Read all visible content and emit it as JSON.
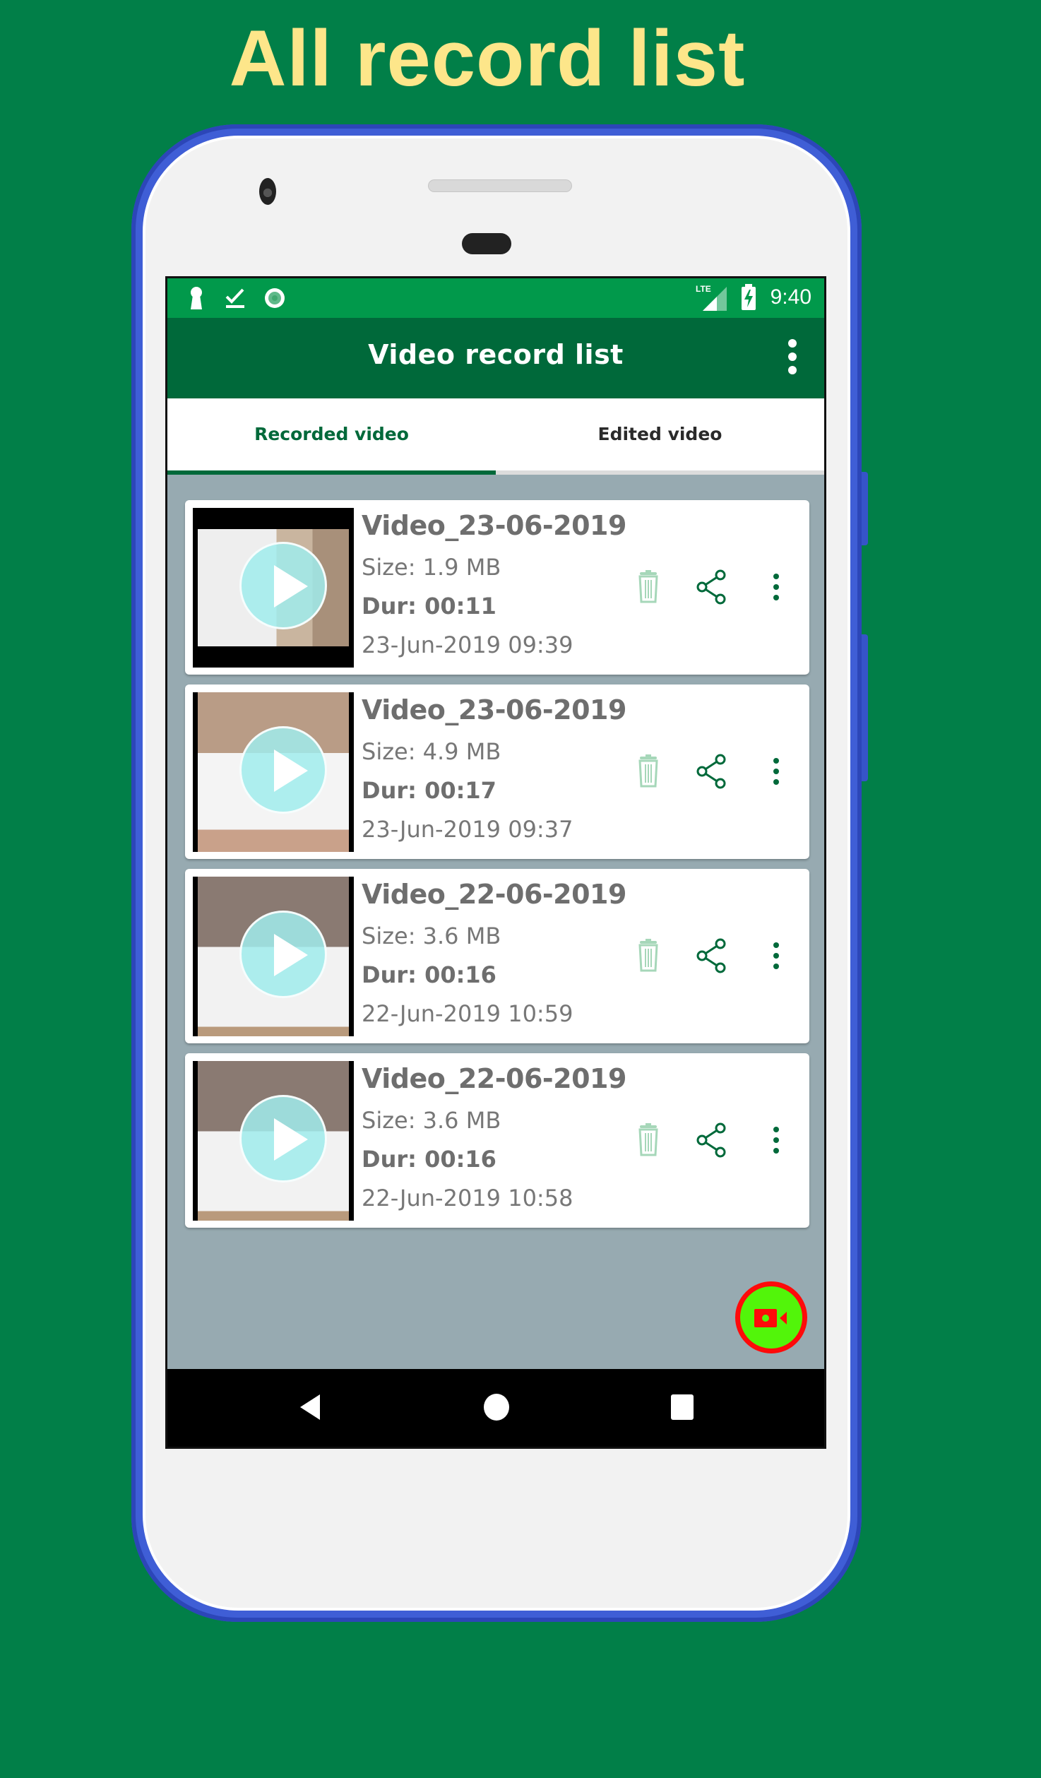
{
  "promo": {
    "title": "All record list"
  },
  "colors": {
    "background": "#017f48",
    "title_yellow": "#fde68a",
    "status_bar": "#01994b",
    "app_bar": "#00693a",
    "accent": "#00693a",
    "list_bg": "#97aab1",
    "fab_fill": "#52f50a",
    "fab_ring": "#ff0a0a"
  },
  "status_bar": {
    "left_icons": [
      "keyhole-icon",
      "download-done-icon",
      "record-circle-icon"
    ],
    "network_label": "LTE",
    "time": "9:40"
  },
  "app_bar": {
    "title": "Video record list",
    "menu_icon": "more-vert-icon"
  },
  "tabs": [
    {
      "label": "Recorded video",
      "selected": true
    },
    {
      "label": "Edited video",
      "selected": false
    }
  ],
  "videos": [
    {
      "title": "Video_23-06-2019",
      "size": "Size: 1.9 MB",
      "duration": "Dur: 00:11",
      "date": "23-Jun-2019 09:39"
    },
    {
      "title": "Video_23-06-2019",
      "size": "Size: 4.9 MB",
      "duration": "Dur: 00:17",
      "date": "23-Jun-2019 09:37"
    },
    {
      "title": "Video_22-06-2019",
      "size": "Size: 3.6 MB",
      "duration": "Dur: 00:16",
      "date": "22-Jun-2019 10:59"
    },
    {
      "title": "Video_22-06-2019",
      "size": "Size: 3.6 MB",
      "duration": "Dur: 00:16",
      "date": "22-Jun-2019 10:58"
    }
  ],
  "item_actions": [
    "delete-icon",
    "share-icon",
    "more-vert-icon"
  ],
  "fab": {
    "icon": "videocam-icon"
  },
  "nav_bar": {
    "buttons": [
      "back",
      "home",
      "recents"
    ]
  }
}
